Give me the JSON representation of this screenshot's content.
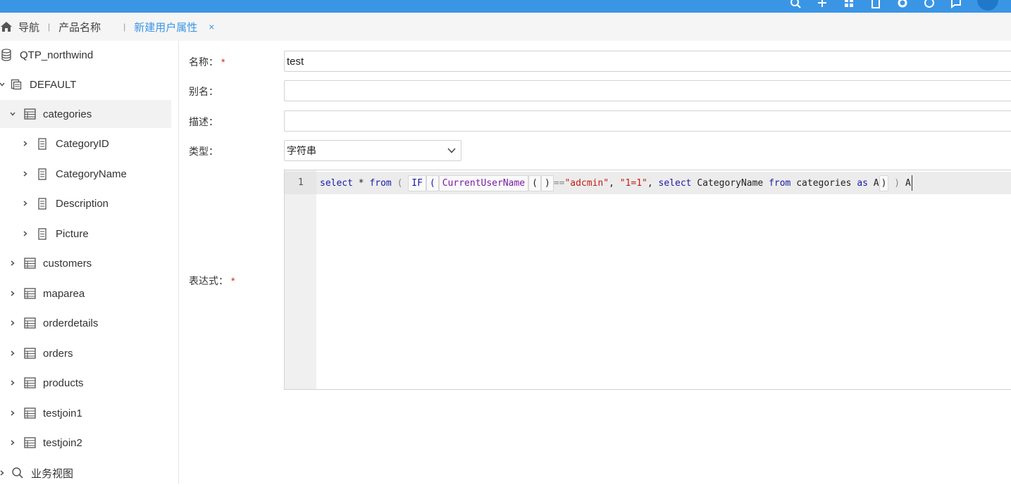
{
  "breadcrumb": {
    "home": "导航",
    "product": "产品名称",
    "tab": "新建用户属性",
    "close": "×"
  },
  "tree": {
    "root": "QTP_northwind",
    "schema": "DEFAULT",
    "tables": [
      {
        "label": "categories",
        "expanded": true,
        "selected": true,
        "columns": [
          "CategoryID",
          "CategoryName",
          "Description",
          "Picture"
        ]
      },
      {
        "label": "customers"
      },
      {
        "label": "maparea"
      },
      {
        "label": "orderdetails"
      },
      {
        "label": "orders"
      },
      {
        "label": "products"
      },
      {
        "label": "testjoin1"
      },
      {
        "label": "testjoin2"
      }
    ],
    "views": "业务视图"
  },
  "form": {
    "name_label": "名称：",
    "name_required": "*",
    "name_value": "test",
    "alias_label": "别名：",
    "alias_value": "",
    "desc_label": "描述：",
    "desc_value": "",
    "type_label": "类型：",
    "type_value": "字符串",
    "expr_label": "表达式：",
    "expr_required": "*"
  },
  "editor": {
    "line_number": "1",
    "tokens": {
      "select": "select",
      "star": " * ",
      "from": "from",
      "lparen1": " ( ",
      "if": "IF",
      "lparen2": "(",
      "fn": "CurrentUserName",
      "lparen3": "(",
      "rparen3": ")",
      "eq": "==",
      "str1": "\"adcmin\"",
      "comma1": ", ",
      "str2": "\"1=1\"",
      "comma2": ", ",
      "select2": "select",
      "col": " CategoryName ",
      "from2": "from",
      "tbl": " categories ",
      "as": "as",
      "alias1": " A",
      "rparen2": ")",
      "rparen1": " ) ",
      "alias2": "A"
    }
  },
  "colors": {
    "topbar": "#3b95e5",
    "accent": "#3b95e5",
    "required": "#e02020",
    "keyword": "#1a1aa6",
    "string": "#c41a16"
  }
}
